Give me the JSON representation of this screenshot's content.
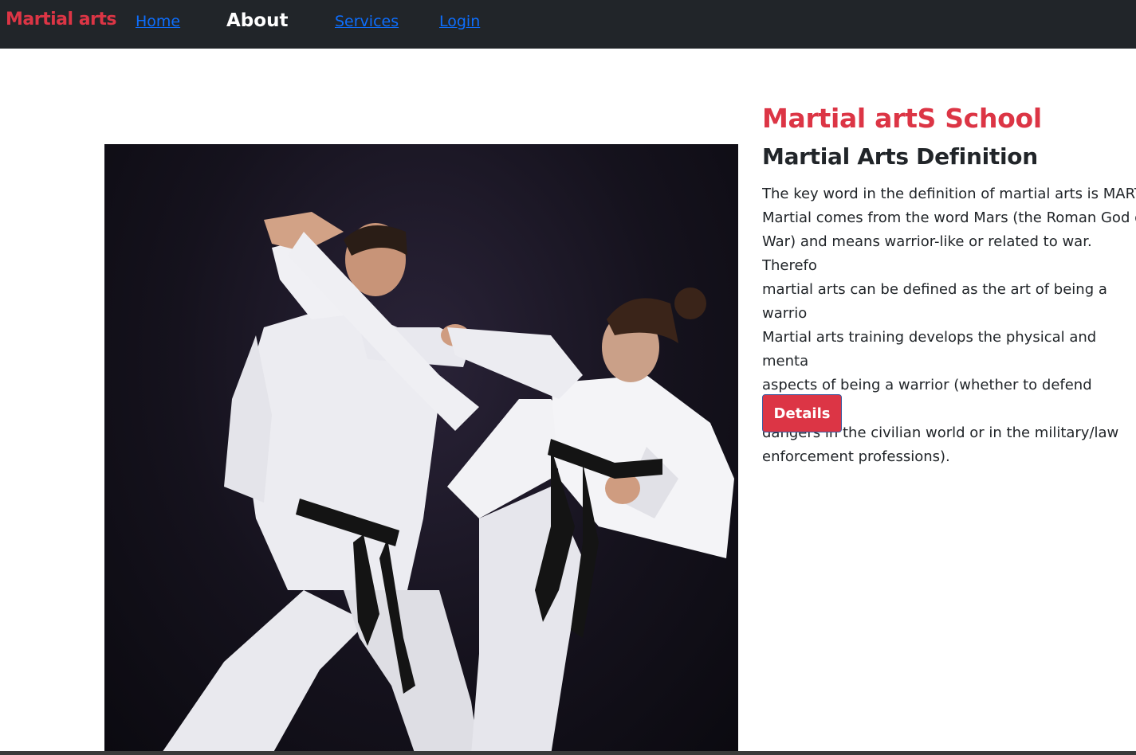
{
  "navbar": {
    "brand": "Martial arts",
    "links": [
      {
        "label": "Home"
      },
      {
        "label": "About"
      },
      {
        "label": "Services"
      },
      {
        "label": "Login"
      }
    ]
  },
  "hero": {
    "image": "karate-sparring-photo"
  },
  "content": {
    "title": "Martial artS School",
    "subtitle": "Martial Arts Definition",
    "lines": [
      "The key word in the definition of martial arts is MART",
      "Martial comes from the word Mars (the Roman God o",
      "War) and means warrior-like or related to war. Therefo",
      "martial arts can be defined as the art of being a warrio",
      "Martial arts training develops the physical and menta",
      "aspects of being a warrior (whether to defend against",
      "dangers in the civilian world or in the military/law",
      "enforcement professions)."
    ],
    "button_label": "Details"
  },
  "colors": {
    "navbar_bg": "#212529",
    "brand": "#dc3545",
    "link": "#0d6efd",
    "button": "#dc3545"
  }
}
